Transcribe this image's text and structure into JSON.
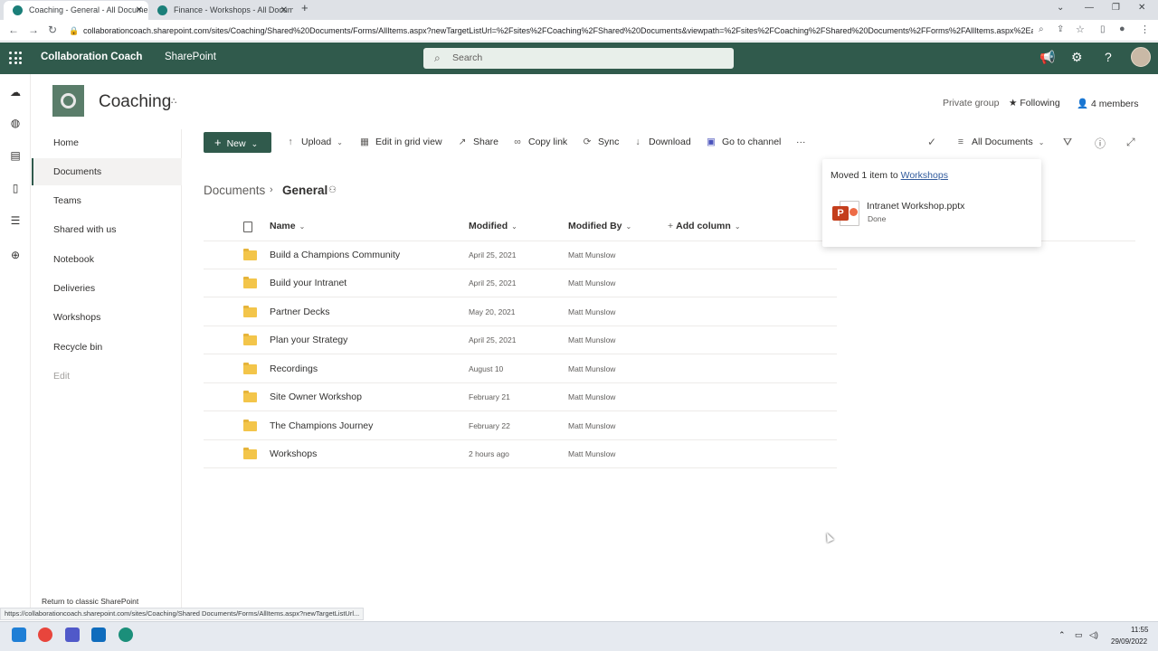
{
  "browser": {
    "tabs": [
      {
        "title": "Coaching - General - All Docume",
        "active": true
      },
      {
        "title": "Finance - Workshops - All Docum",
        "active": false
      }
    ],
    "url": "collaborationcoach.sharepoint.com/sites/Coaching/Shared%20Documents/Forms/AllItems.aspx?newTargetListUrl=%2Fsites%2FCoaching%2FShared%20Documents&viewpath=%2Fsites%2FCoaching%2FShared%20Documents%2FForms%2FAllItems.aspx%2Ea..."
  },
  "suitebar": {
    "org_name": "Collaboration Coach",
    "app_name": "SharePoint",
    "search_placeholder": "Search",
    "brand_color": "#305a4c"
  },
  "site": {
    "title": "Coaching",
    "privacy": "Private group",
    "following": "Following",
    "members": "4 members"
  },
  "leftnav": {
    "items": [
      "Home",
      "Documents",
      "Teams",
      "Shared with us",
      "Notebook",
      "Deliveries",
      "Workshops",
      "Recycle bin",
      "Edit"
    ],
    "selected": "Documents",
    "classic_link": "Return to classic SharePoint"
  },
  "commandbar": {
    "new": "New",
    "upload": "Upload",
    "grid": "Edit in grid view",
    "share": "Share",
    "copy_link": "Copy link",
    "sync": "Sync",
    "download": "Download",
    "go_to_channel": "Go to channel",
    "more": "···",
    "view": "All Documents"
  },
  "breadcrumb": {
    "root": "Documents",
    "current": "General"
  },
  "table": {
    "columns": {
      "name": "Name",
      "modified": "Modified",
      "modified_by": "Modified By",
      "add_column": "Add column"
    },
    "rows": [
      {
        "name": "Build a Champions Community",
        "modified": "April 25, 2021",
        "by": "Matt Munslow"
      },
      {
        "name": "Build your Intranet",
        "modified": "April 25, 2021",
        "by": "Matt Munslow"
      },
      {
        "name": "Partner Decks",
        "modified": "May 20, 2021",
        "by": "Matt Munslow"
      },
      {
        "name": "Plan your Strategy",
        "modified": "April 25, 2021",
        "by": "Matt Munslow"
      },
      {
        "name": "Recordings",
        "modified": "August 10",
        "by": "Matt Munslow"
      },
      {
        "name": "Site Owner Workshop",
        "modified": "February 21",
        "by": "Matt Munslow"
      },
      {
        "name": "The Champions Journey",
        "modified": "February 22",
        "by": "Matt Munslow"
      },
      {
        "name": "Workshops",
        "modified": "2 hours ago",
        "by": "Matt Munslow"
      }
    ]
  },
  "toast": {
    "message_prefix": "Moved 1 item to",
    "link": "Workshops",
    "file_name": "Intranet Workshop.pptx",
    "status": "Done"
  },
  "status_url": "https://collaborationcoach.sharepoint.com/sites/Coaching/Shared Documents/Forms/AllItems.aspx?newTargetListUrl...",
  "taskbar": {
    "time": "11:55",
    "date": "29/09/2022"
  }
}
